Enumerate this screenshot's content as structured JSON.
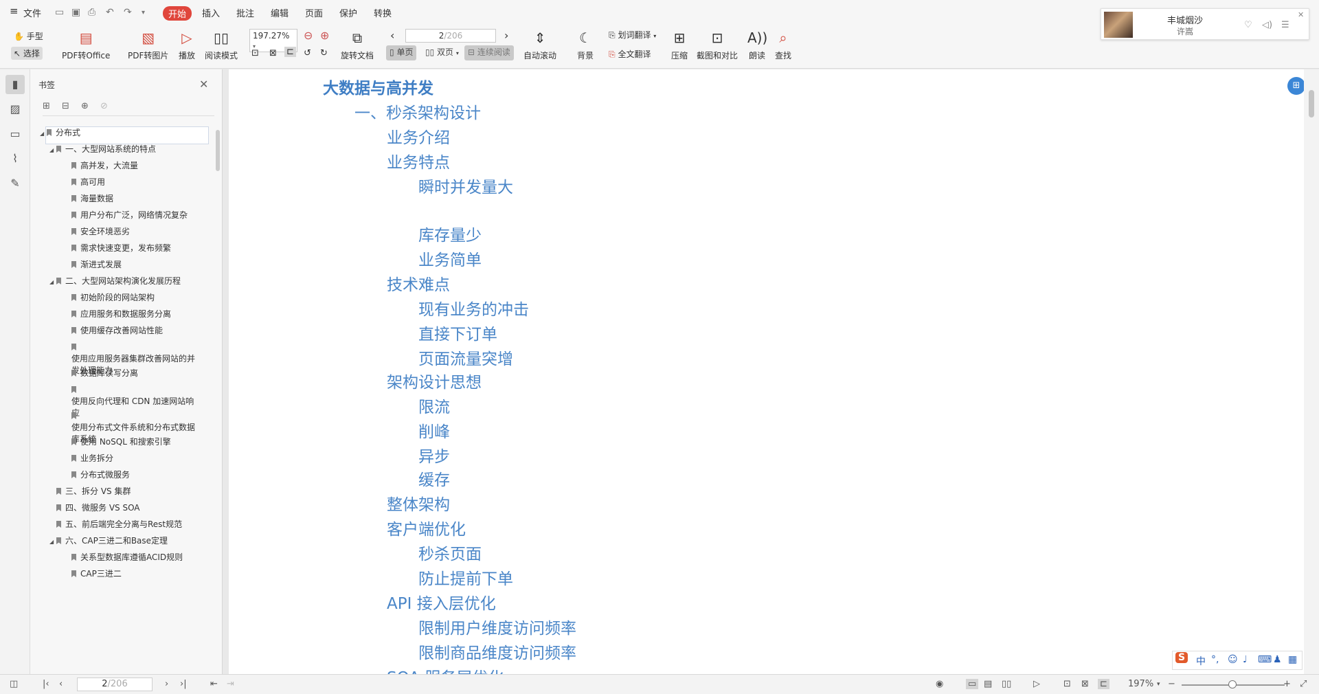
{
  "menu": {
    "hamburger": "≡",
    "file": "文件",
    "tabs": [
      "开始",
      "插入",
      "批注",
      "编辑",
      "页面",
      "保护",
      "转换"
    ]
  },
  "toolbar": {
    "hand": "手型",
    "select": "选择",
    "pdf_to_office": "PDF转Office",
    "pdf_to_image": "PDF转图片",
    "play": "播放",
    "read_mode": "阅读模式",
    "zoom_value": "197.27%",
    "rotate_doc": "旋转文档",
    "page_value": "2",
    "page_total": "/206",
    "single_page": "单页",
    "double_page": "双页",
    "continuous_read": "连续阅读",
    "auto_scroll": "自动滚动",
    "background": "背景",
    "word_translate": "划词翻译",
    "full_translate": "全文翻译",
    "compress": "压缩",
    "screenshot_compare": "截图和对比",
    "read_aloud": "朗读",
    "find": "查找"
  },
  "music": {
    "title": "丰城烟沙",
    "artist": "许嵩"
  },
  "colors": {
    "accent_red": "#e0463c",
    "doc_text_blue": "#4a86c8",
    "heading_blue": "#3f7ec4"
  },
  "bookmarks": {
    "title": "书签",
    "items": [
      "分布式",
      "一、大型网站系统的特点",
      "高并发，大流量",
      "高可用",
      "海量数据",
      "用户分布广泛，网络情况复杂",
      "安全环境恶劣",
      "需求快速变更，发布频繁",
      "渐进式发展",
      "二、大型网站架构演化发展历程",
      "初始阶段的网站架构",
      "应用服务和数据服务分离",
      "使用缓存改善网站性能",
      "使用应用服务器集群改善网站的并发处理能力",
      "数据库读写分离",
      "使用反向代理和 CDN 加速网站响应",
      "使用分布式文件系统和分布式数据库系统",
      "使用 NoSQL 和搜索引擎",
      "业务拆分",
      "分布式微服务",
      "三、拆分 VS 集群",
      "四、微服务 VS SOA",
      "五、前后端完全分离与Rest规范",
      "六、CAP三进二和Base定理",
      "关系型数据库遵循ACID规则",
      "CAP三进二"
    ]
  },
  "document": {
    "lines": [
      "大数据与高并发",
      "一、秒杀架构设计",
      "业务介绍",
      "业务特点",
      "瞬时并发量大",
      "库存量少",
      "业务简单",
      "技术难点",
      "现有业务的冲击",
      "直接下订单",
      "页面流量突增",
      "架构设计思想",
      "限流",
      "削峰",
      "异步",
      "缓存",
      "整体架构",
      "客户端优化",
      "秒杀页面",
      "防止提前下单",
      "API 接入层优化",
      "限制用户维度访问频率",
      "限制商品维度访问频率",
      "SOA 服务层优化"
    ]
  },
  "ime": {
    "logo": "S",
    "lang": "中",
    "punct": "°,"
  },
  "status": {
    "page_value": "2",
    "page_total": "/206",
    "zoom": "197%",
    "minus": "−",
    "plus": "+"
  }
}
